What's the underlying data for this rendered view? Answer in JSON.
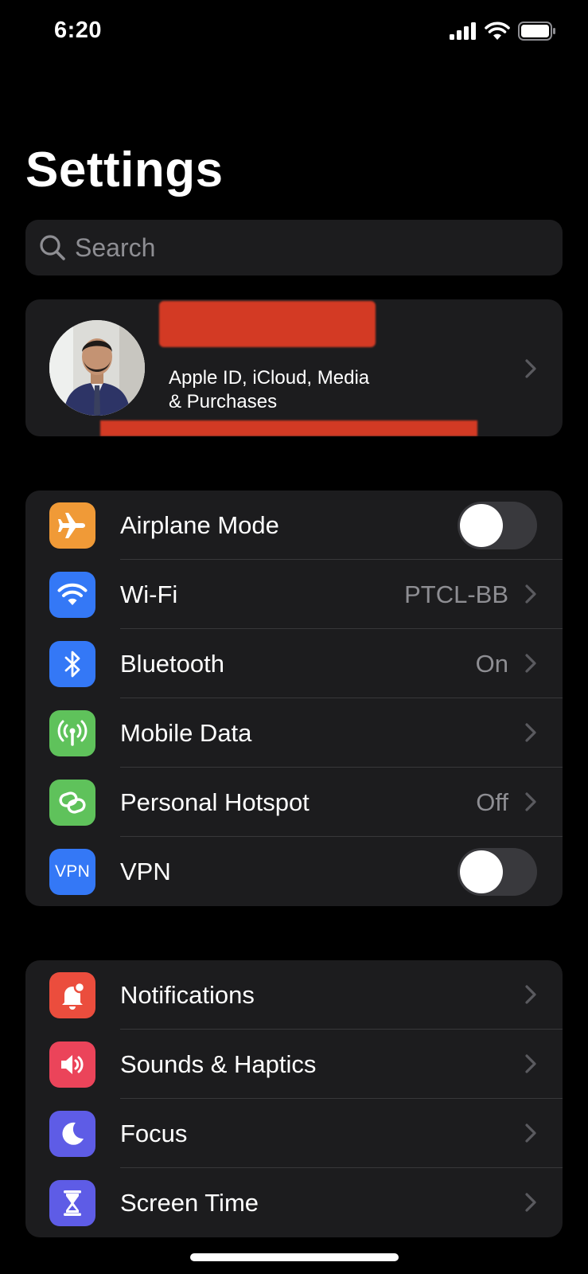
{
  "status_bar": {
    "time": "6:20"
  },
  "header": {
    "title": "Settings"
  },
  "search": {
    "placeholder": "Search"
  },
  "profile": {
    "subtitle_line1": "Apple ID, iCloud, Media",
    "subtitle_line2": "& Purchases"
  },
  "network_group": {
    "airplane": {
      "label": "Airplane Mode",
      "toggle": "off"
    },
    "wifi": {
      "label": "Wi-Fi",
      "value": "PTCL-BB"
    },
    "bluetooth": {
      "label": "Bluetooth",
      "value": "On"
    },
    "mobile_data": {
      "label": "Mobile Data"
    },
    "hotspot": {
      "label": "Personal Hotspot",
      "value": "Off"
    },
    "vpn": {
      "label": "VPN",
      "icon_text": "VPN",
      "toggle": "off"
    }
  },
  "general_group": {
    "notifications": {
      "label": "Notifications"
    },
    "sounds": {
      "label": "Sounds & Haptics"
    },
    "focus": {
      "label": "Focus"
    },
    "screen_time": {
      "label": "Screen Time"
    }
  },
  "colors": {
    "airplane": "#f09a37",
    "wifi": "#3478f6",
    "bluetooth": "#3478f6",
    "mobile_data": "#5fc25b",
    "hotspot": "#5fc25b",
    "vpn": "#3478f6",
    "notifications": "#eb4d3d",
    "sounds": "#eb445a",
    "focus": "#5e5ce6",
    "screen_time": "#5e5ce6"
  }
}
